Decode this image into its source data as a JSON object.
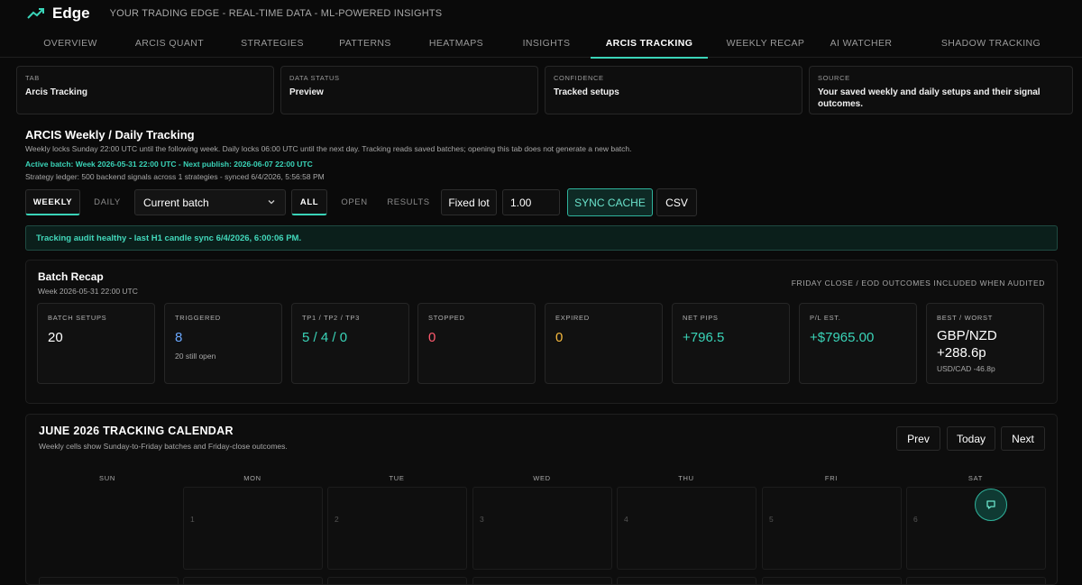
{
  "header": {
    "brand": "Edge",
    "tagline": "YOUR TRADING EDGE - REAL-TIME DATA - ML-POWERED INSIGHTS"
  },
  "nav": [
    {
      "label": "OVERVIEW"
    },
    {
      "label": "ARCIS QUANT"
    },
    {
      "label": "STRATEGIES"
    },
    {
      "label": "PATTERNS"
    },
    {
      "label": "HEATMAPS"
    },
    {
      "label": "INSIGHTS"
    },
    {
      "label": "ARCIS TRACKING",
      "active": true
    },
    {
      "label": "WEEKLY RECAP"
    },
    {
      "label": "AI WATCHER"
    },
    {
      "label": "SHADOW TRACKING"
    }
  ],
  "info_cards": [
    {
      "label": "TAB",
      "value": "Arcis Tracking"
    },
    {
      "label": "DATA STATUS",
      "value": "Preview"
    },
    {
      "label": "CONFIDENCE",
      "value": "Tracked setups"
    },
    {
      "label": "SOURCE",
      "value": "Your saved weekly and daily setups and their signal outcomes."
    }
  ],
  "section": {
    "title": "ARCIS Weekly / Daily Tracking",
    "description": "Weekly locks Sunday 22:00 UTC until the following week. Daily locks 06:00 UTC until the next day. Tracking reads saved batches; opening this tab does not generate a new batch.",
    "active_batch": "Active batch: Week 2026-05-31 22:00 UTC - Next publish: 2026-06-07 22:00 UTC",
    "ledger": "Strategy ledger: 500 backend signals across 1 strategies - synced 6/4/2026, 5:56:58 PM"
  },
  "controls": {
    "weekly": "WEEKLY",
    "daily": "DAILY",
    "batch_select": "Current batch",
    "all": "ALL",
    "open": "OPEN",
    "results": "RESULTS",
    "fixed_lot": "Fixed lot",
    "lot_value": "1.00",
    "sync": "SYNC CACHE",
    "csv": "CSV"
  },
  "audit": "Tracking audit healthy - last H1 candle sync 6/4/2026, 6:00:06 PM.",
  "recap": {
    "title": "Batch Recap",
    "subtitle": "Week 2026-05-31 22:00 UTC",
    "note": "FRIDAY CLOSE / EOD OUTCOMES INCLUDED WHEN AUDITED",
    "stats": [
      {
        "label": "BATCH SETUPS",
        "value": "20",
        "extra": "",
        "color": "#ffffff"
      },
      {
        "label": "TRIGGERED",
        "value": "8",
        "extra": "20 still open",
        "color": "#6aa8ff"
      },
      {
        "label": "TP1 / TP2 / TP3",
        "value": "5 / 4 / 0",
        "extra": "",
        "color": "#3ad4b8"
      },
      {
        "label": "STOPPED",
        "value": "0",
        "extra": "",
        "color": "#ff5a6e"
      },
      {
        "label": "EXPIRED",
        "value": "0",
        "extra": "",
        "color": "#f5b83d"
      },
      {
        "label": "NET PIPS",
        "value": "+796.5",
        "extra": "",
        "color": "#3ad4b8"
      },
      {
        "label": "P/L EST.",
        "value": "+$7965.00",
        "extra": "",
        "color": "#3ad4b8"
      },
      {
        "label": "BEST / WORST",
        "value": "GBP/NZD +288.6p",
        "extra": "USD/CAD -46.8p",
        "color": "#e8e8e8"
      }
    ]
  },
  "calendar": {
    "title": "JUNE 2026 TRACKING CALENDAR",
    "subtitle": "Weekly cells show Sunday-to-Friday batches and Friday-close outcomes.",
    "prev": "Prev",
    "today": "Today",
    "next": "Next",
    "days": [
      "SUN",
      "MON",
      "TUE",
      "WED",
      "THU",
      "FRI",
      "SAT"
    ],
    "dates": [
      "",
      "1",
      "2",
      "3",
      "4",
      "5",
      "6"
    ]
  }
}
